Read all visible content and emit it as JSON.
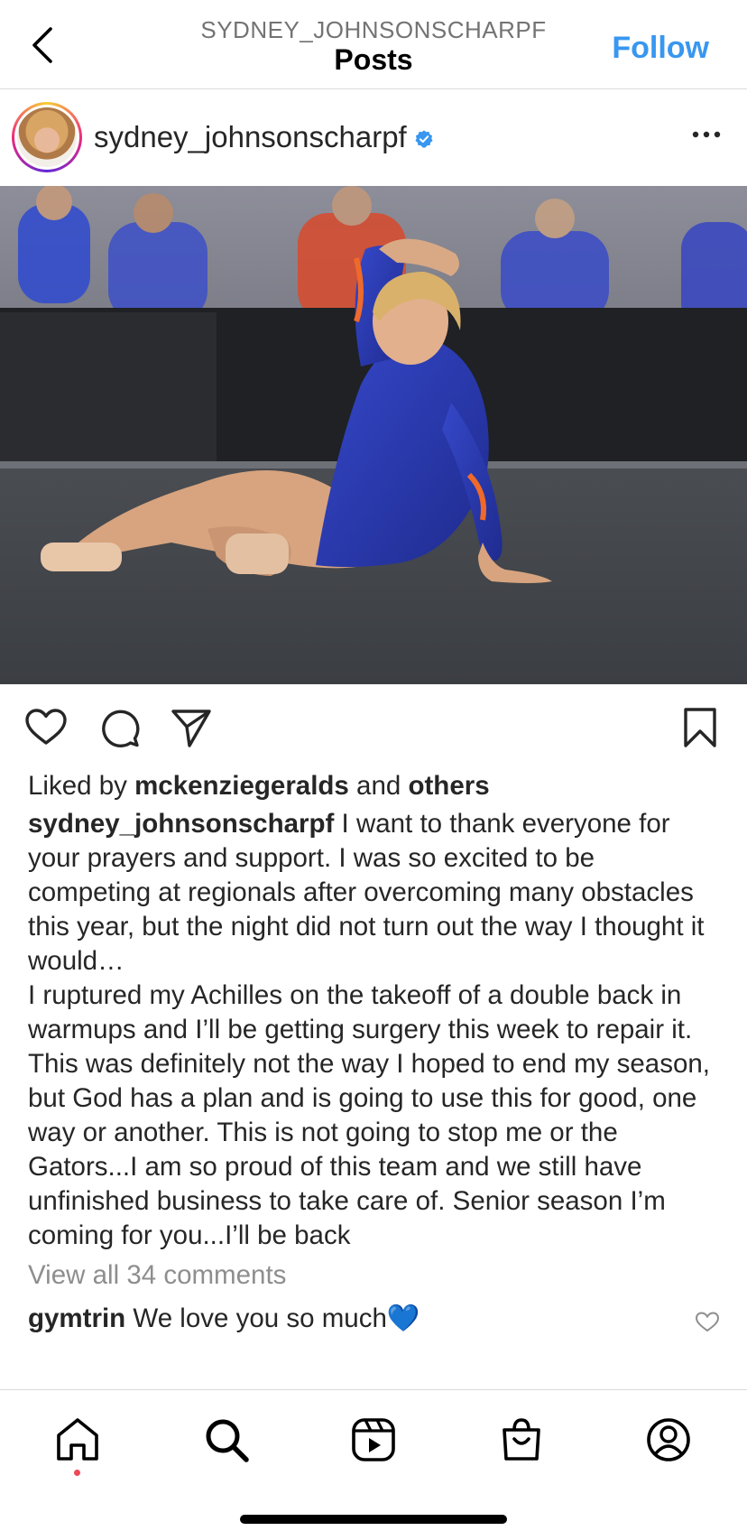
{
  "header": {
    "username": "SYDNEY_JOHNSONSCHARPF",
    "title": "Posts",
    "follow_label": "Follow"
  },
  "post": {
    "username": "sydney_johnsonscharpf",
    "verified": true,
    "likes": {
      "prefix": "Liked by ",
      "user": "mckenziegeralds",
      "middle": " and ",
      "others": "others"
    },
    "caption": {
      "username": "sydney_johnsonscharpf",
      "paragraph1": "I want to thank everyone for your prayers and support. I was so excited to be competing at regionals after overcoming many obstacles this year, but the night did not turn out the way I thought it would…",
      "paragraph2": "I ruptured my Achilles on the takeoff of a double back in warmups and I’ll be getting surgery this week to repair it. This was definitely not the way I hoped to end my season, but God has a plan and is going to use this for good, one way or another. This is not going to stop me or the Gators...I am so proud of this team and we still have unfinished business to take care of. Senior season I’m coming for you...I’ll be back"
    },
    "view_all_comments": "View all 34 comments",
    "top_comment": {
      "username": "gymtrin",
      "text": "We love you so much💙"
    }
  },
  "icons": {
    "back": "chevron-left-icon",
    "verified": "verified-badge-icon",
    "more": "more-horizontal-icon",
    "like": "heart-icon",
    "comment": "comment-icon",
    "share": "send-icon",
    "save": "bookmark-icon",
    "home": "home-icon",
    "search": "search-icon",
    "reels": "reels-icon",
    "shop": "shop-icon",
    "profile": "profile-icon"
  },
  "colors": {
    "accent": "#3897f0",
    "text": "#262626",
    "muted": "#8e8e8e",
    "notification": "#ed4956"
  }
}
